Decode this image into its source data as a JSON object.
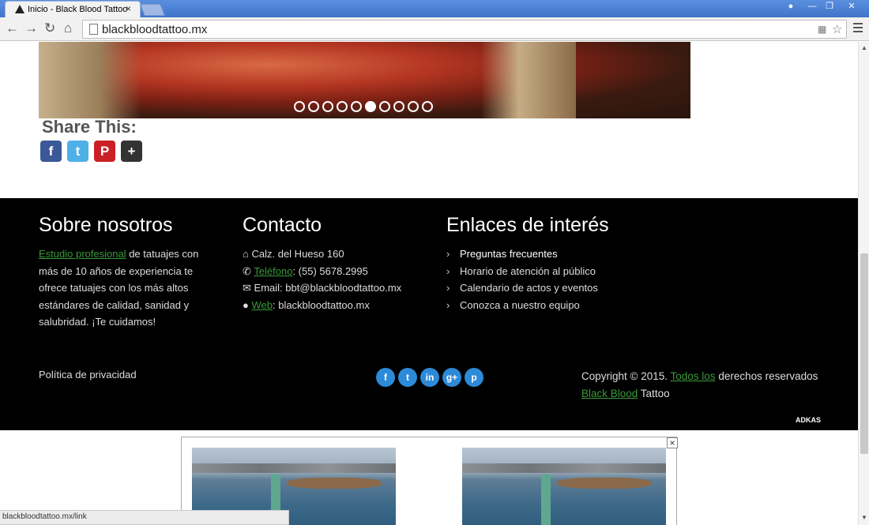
{
  "browser": {
    "tab_title": "Inicio - Black Blood Tattoo",
    "tab_close": "×",
    "url": "blackbloodtattoo.mx",
    "status_url": "blackbloodtattoo.mx/link"
  },
  "slider": {
    "dot_count": 10,
    "active_dot": 6
  },
  "share": {
    "title": "Share This:",
    "buttons": [
      {
        "name": "facebook",
        "glyph": "f",
        "color": "#3b5998"
      },
      {
        "name": "twitter",
        "glyph": "t",
        "color": "#4fb0e8"
      },
      {
        "name": "pinterest",
        "glyph": "P",
        "color": "#cb2027"
      },
      {
        "name": "more",
        "glyph": "+",
        "color": "#333333"
      }
    ]
  },
  "footer": {
    "about": {
      "title": "Sobre nosotros",
      "link": "Estudio profesional",
      "text": " de tatuajes con más de 10 años de experiencia te ofrece tatuajes con los más altos estándares de calidad, sanidad y salubridad. ¡Te cuidamos!"
    },
    "contact": {
      "title": "Contacto",
      "address": "Calz. del Hueso 160",
      "phone_label": "Teléfono",
      "phone": ": (55) 5678.2995",
      "email": "Email: bbt@blackbloodtattoo.mx",
      "web_label": "Web",
      "web": ": blackbloodtattoo.mx"
    },
    "links": {
      "title": "Enlaces de interés",
      "items": [
        "Preguntas frecuentes",
        "Horario de atención al público",
        "Calendario de actos y eventos",
        "Conozca a nuestro equipo"
      ]
    },
    "privacy": "Política de privacidad",
    "social": [
      "f",
      "t",
      "in",
      "g+",
      "p"
    ],
    "copyright": {
      "prefix": "Copyright © 2015. ",
      "link1": "Todos los",
      "middle": " derechos reservados",
      "link2": "Black Blood",
      "suffix": " Tattoo"
    },
    "adkas": "ADKAS"
  },
  "ad": {
    "close": "×"
  }
}
